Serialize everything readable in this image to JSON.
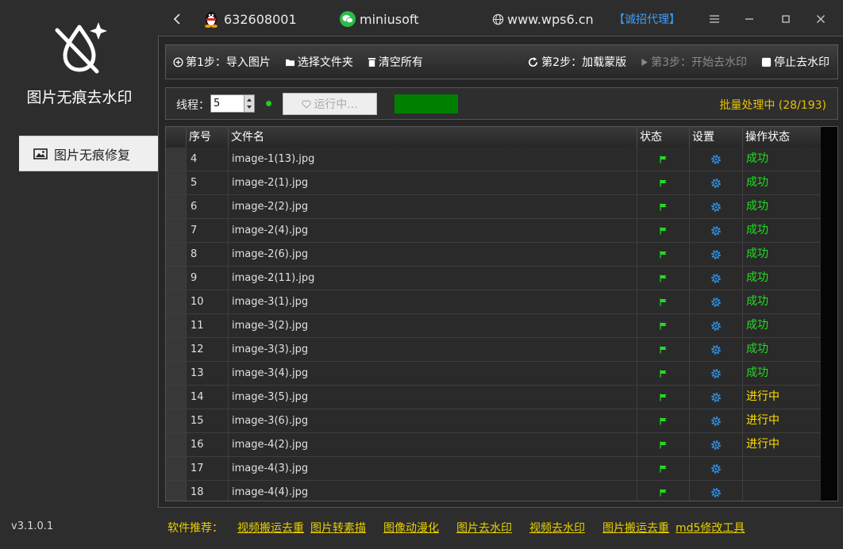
{
  "app": {
    "title": "图片无痕去水印",
    "version": "v3.1.0.1"
  },
  "sidebar": {
    "items": [
      {
        "label": "图片无痕修复",
        "icon": "image-icon"
      }
    ]
  },
  "topbar": {
    "qq": "632608001",
    "wechat": "miniusoft",
    "website": "www.wps6.cn",
    "agent": "【诚招代理】"
  },
  "toolbar": {
    "step1": "第1步：导入图片",
    "select_folder": "选择文件夹",
    "clear_all": "清空所有",
    "step2": "第2步：加载蒙版",
    "step3": "第3步：开始去水印",
    "stop": "停止去水印"
  },
  "thread": {
    "label": "线程：",
    "value": "5",
    "run_label": "运行中...",
    "progress": 1.0,
    "batch_status": "批量处理中 (28/193)"
  },
  "table": {
    "headers": [
      "序号",
      "文件名",
      "状态",
      "设置",
      "操作状态"
    ],
    "rows": [
      {
        "no": "4",
        "file": "image-1(13).jpg",
        "status": "成功",
        "kind": "ok"
      },
      {
        "no": "5",
        "file": "image-2(1).jpg",
        "status": "成功",
        "kind": "ok"
      },
      {
        "no": "6",
        "file": "image-2(2).jpg",
        "status": "成功",
        "kind": "ok"
      },
      {
        "no": "7",
        "file": "image-2(4).jpg",
        "status": "成功",
        "kind": "ok"
      },
      {
        "no": "8",
        "file": "image-2(6).jpg",
        "status": "成功",
        "kind": "ok"
      },
      {
        "no": "9",
        "file": "image-2(11).jpg",
        "status": "成功",
        "kind": "ok"
      },
      {
        "no": "10",
        "file": "image-3(1).jpg",
        "status": "成功",
        "kind": "ok"
      },
      {
        "no": "11",
        "file": "image-3(2).jpg",
        "status": "成功",
        "kind": "ok"
      },
      {
        "no": "12",
        "file": "image-3(3).jpg",
        "status": "成功",
        "kind": "ok"
      },
      {
        "no": "13",
        "file": "image-3(4).jpg",
        "status": "成功",
        "kind": "ok"
      },
      {
        "no": "14",
        "file": "image-3(5).jpg",
        "status": "进行中",
        "kind": "run"
      },
      {
        "no": "15",
        "file": "image-3(6).jpg",
        "status": "进行中",
        "kind": "run"
      },
      {
        "no": "16",
        "file": "image-4(2).jpg",
        "status": "进行中",
        "kind": "run"
      },
      {
        "no": "17",
        "file": "image-4(3).jpg",
        "status": "",
        "kind": "none"
      },
      {
        "no": "18",
        "file": "image-4(4).jpg",
        "status": "",
        "kind": "none"
      }
    ]
  },
  "recommend": {
    "label": "软件推荐：",
    "links": [
      "视频搬运去重",
      "图片转素描",
      "图像动漫化",
      "图片去水印",
      "视频去水印",
      "图片搬运去重",
      "md5修改工具"
    ]
  },
  "colors": {
    "success": "#22dd22",
    "running": "#ffdd00",
    "accent": "#3aa0ff",
    "flag": "#22dd22",
    "gear": "#2f8fe0"
  }
}
